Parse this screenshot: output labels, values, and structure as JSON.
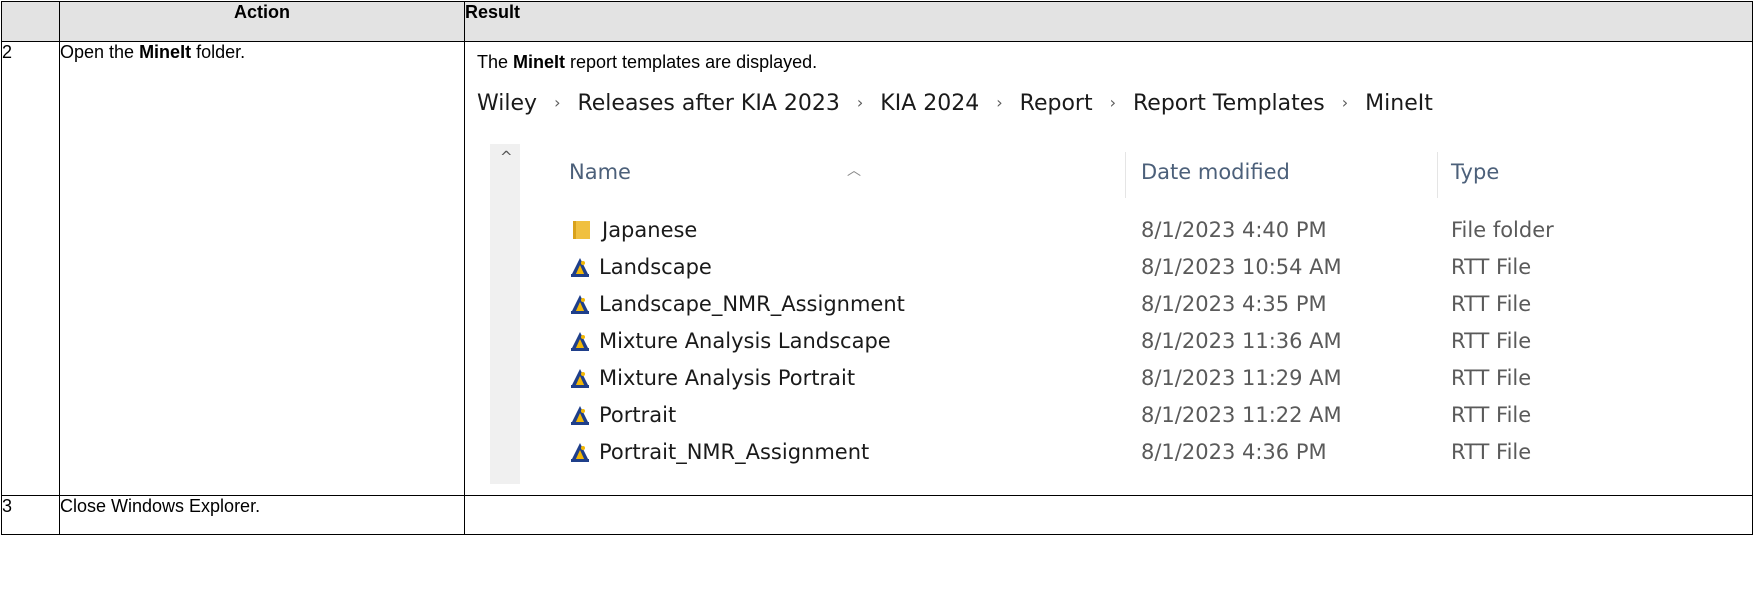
{
  "table": {
    "headers": {
      "num": "",
      "action": "Action",
      "result": "Result"
    },
    "rows": [
      {
        "num": "2",
        "action_pre": "Open the ",
        "action_bold": "MineIt",
        "action_post": " folder.",
        "result_pre": "The ",
        "result_bold": "MineIt",
        "result_post": " report templates are displayed."
      },
      {
        "num": "3",
        "action": "Close Windows Explorer.",
        "result": ""
      }
    ]
  },
  "explorer": {
    "breadcrumb": [
      "Wiley",
      "Releases after KIA 2023",
      "KIA 2024",
      "Report",
      "Report Templates",
      "MineIt"
    ],
    "breadcrumb_sep": "›",
    "columns": {
      "name": "Name",
      "date": "Date modified",
      "type": "Type"
    },
    "files": [
      {
        "name": "Japanese",
        "date": "8/1/2023 4:40 PM",
        "type": "File folder",
        "icon": "folder-icon"
      },
      {
        "name": "Landscape",
        "date": "8/1/2023 10:54 AM",
        "type": "RTT File",
        "icon": "rtt-file-icon"
      },
      {
        "name": "Landscape_NMR_Assignment",
        "date": "8/1/2023 4:35 PM",
        "type": "RTT File",
        "icon": "rtt-file-icon"
      },
      {
        "name": "Mixture Analysis Landscape",
        "date": "8/1/2023 11:36 AM",
        "type": "RTT File",
        "icon": "rtt-file-icon"
      },
      {
        "name": "Mixture Analysis Portrait",
        "date": "8/1/2023 11:29 AM",
        "type": "RTT File",
        "icon": "rtt-file-icon"
      },
      {
        "name": "Portrait",
        "date": "8/1/2023 11:22 AM",
        "type": "RTT File",
        "icon": "rtt-file-icon"
      },
      {
        "name": "Portrait_NMR_Assignment",
        "date": "8/1/2023 4:36 PM",
        "type": "RTT File",
        "icon": "rtt-file-icon"
      }
    ]
  }
}
